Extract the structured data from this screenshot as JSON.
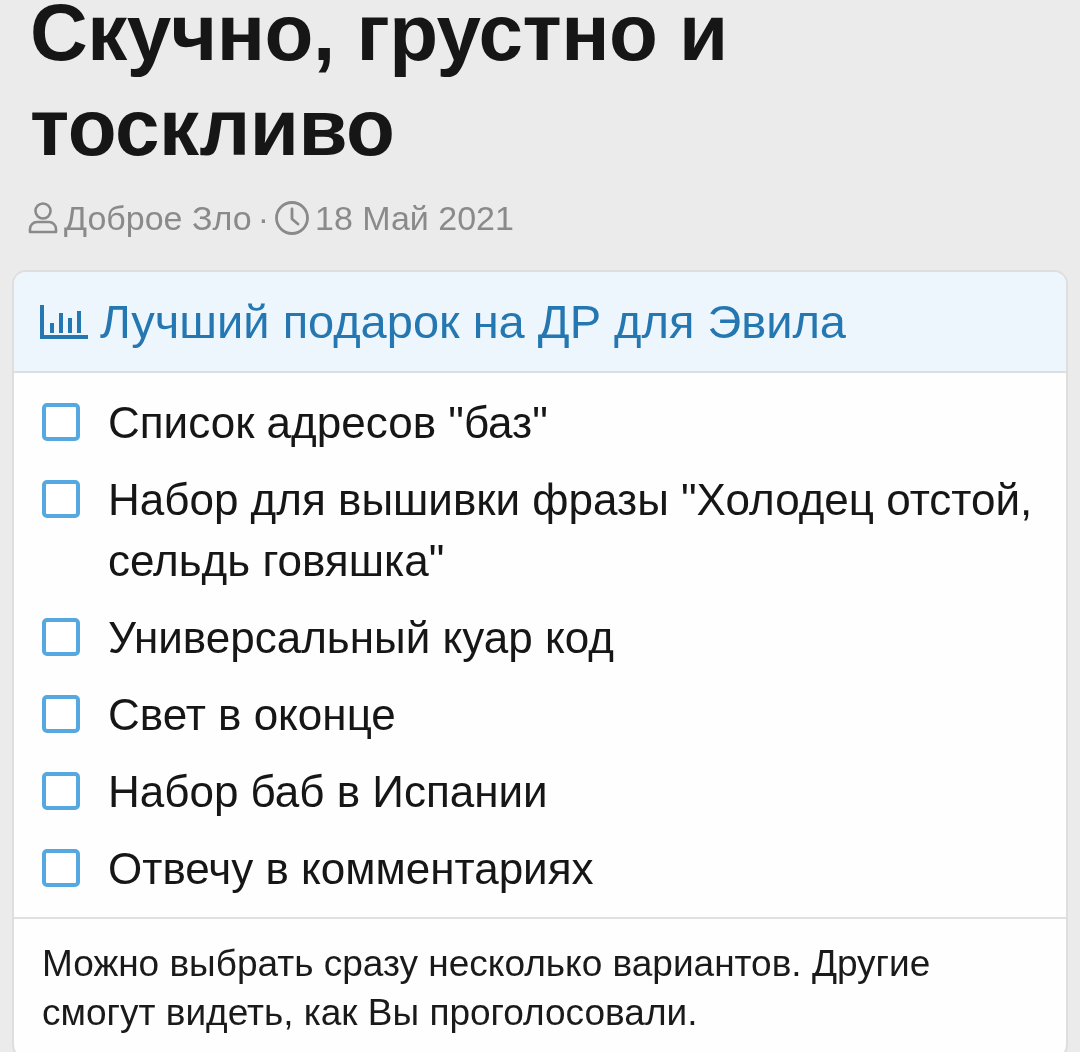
{
  "thread": {
    "title": "Скучно, грустно и тоскливо",
    "author": "Доброе Зло",
    "separator": "·",
    "date": "18 Май 2021"
  },
  "poll": {
    "question": "Лучший подарок на ДР для Эвила",
    "options": [
      {
        "label": "Список адресов \"баз\"",
        "checked": false
      },
      {
        "label": "Набор для вышивки фразы \"Холодец отстой, сельдь говяшка\"",
        "checked": false
      },
      {
        "label": "Универсальный куар код",
        "checked": false
      },
      {
        "label": "Свет в оконце",
        "checked": false
      },
      {
        "label": "Набор баб в Испании",
        "checked": false
      },
      {
        "label": "Отвечу в комментариях",
        "checked": false
      }
    ],
    "note": "Можно выбрать сразу несколько вариантов. Другие смогут видеть, как Вы проголосовали."
  }
}
